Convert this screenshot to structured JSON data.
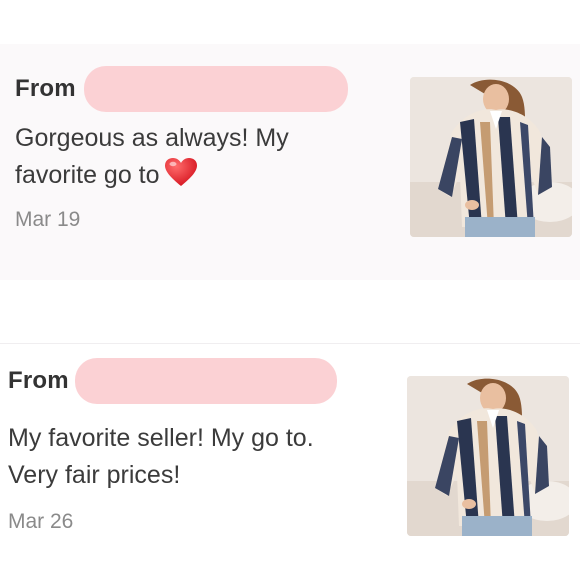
{
  "reviews": [
    {
      "from_label": "From",
      "message": "Gorgeous as always! My favorite go to",
      "emoji": "heart-emoji",
      "date": "Mar 19",
      "thumbnail": "blouse-product-photo"
    },
    {
      "from_label": "From",
      "message": "My favorite seller! My go to. Very fair prices!",
      "date": "Mar 26",
      "thumbnail": "blouse-product-photo"
    }
  ],
  "colors": {
    "card_background": "#fbf9fa",
    "redaction": "#fbd1d4",
    "text": "#3b3b3b",
    "date": "#8a8a8a",
    "heart": "#e0242f"
  }
}
